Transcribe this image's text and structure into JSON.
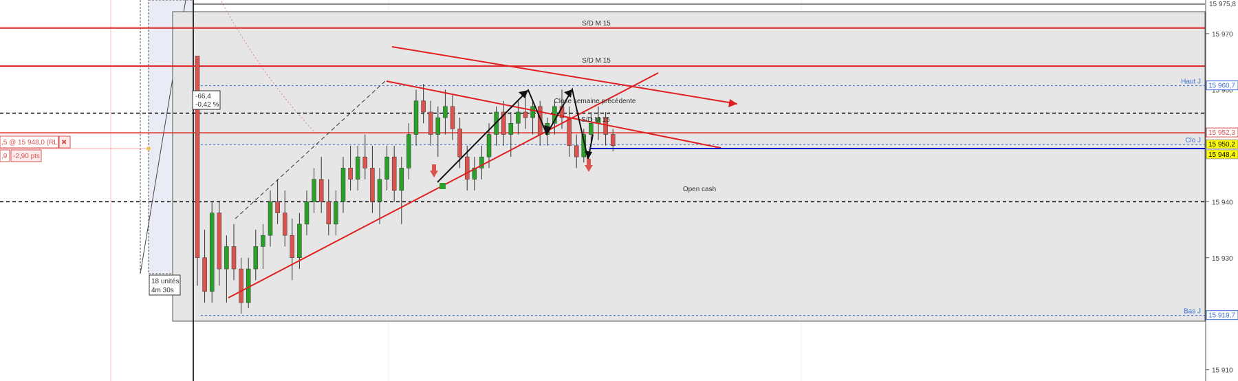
{
  "chart_data": {
    "type": "candlestick",
    "title": "",
    "xlabel": "",
    "ylabel": "",
    "ylim": [
      15908,
      15976
    ],
    "y_axis_side": "right",
    "y_ticks": [
      "15 970",
      "15 960",
      "15 950",
      "15 940",
      "15 930",
      "15 920",
      "15 910"
    ],
    "top_tick_partial": "15 975,8",
    "price_markers": [
      {
        "label": "Haut J",
        "value_text": "15 960,7",
        "value": 15960.7,
        "color": "#3a6fd8",
        "style": "dashed"
      },
      {
        "label": "",
        "value_text": "15 952,3",
        "value": 15952.3,
        "color": "#d9534f",
        "style": "solid"
      },
      {
        "label": "Clo J",
        "value_text": "15 950,2",
        "value": 15950.2,
        "color": "#3a6fd8",
        "style": "dashed",
        "highlight": "#ffff00"
      },
      {
        "label": "",
        "value_text": "15 948,4",
        "value": 15948.4,
        "color": "#0000cc",
        "style": "solid",
        "highlight": "#ffff00"
      },
      {
        "label": "Bas J",
        "value_text": "15 919,7",
        "value": 15919.7,
        "color": "#3a6fd8",
        "style": "dashed"
      }
    ],
    "horizontal_lines": [
      {
        "label": "S/D M 15",
        "value": 15971.0,
        "color": "#e02020"
      },
      {
        "label": "S/D M 15",
        "value": 15964.2,
        "color": "#e02020"
      },
      {
        "label": "Close semaine précédente",
        "value": 15955.8,
        "color": "#111111"
      },
      {
        "label": "Open cash",
        "value": 15940.0,
        "color": "#111111"
      }
    ],
    "candles_ohlc": [
      [
        15966,
        15966,
        15925,
        15930
      ],
      [
        15930,
        15935,
        15922,
        15924
      ],
      [
        15924,
        15940,
        15922,
        15938
      ],
      [
        15938,
        15940,
        15925,
        15928
      ],
      [
        15928,
        15934,
        15922,
        15932
      ],
      [
        15932,
        15936,
        15926,
        15928
      ],
      [
        15928,
        15930,
        15920,
        15922
      ],
      [
        15922,
        15930,
        15921,
        15928
      ],
      [
        15928,
        15935,
        15926,
        15932
      ],
      [
        15932,
        15936,
        15928,
        15934
      ],
      [
        15934,
        15942,
        15932,
        15940
      ],
      [
        15940,
        15944,
        15936,
        15938
      ],
      [
        15938,
        15942,
        15932,
        15934
      ],
      [
        15934,
        15937,
        15926,
        15930
      ],
      [
        15930,
        15938,
        15928,
        15936
      ],
      [
        15936,
        15942,
        15934,
        15940
      ],
      [
        15940,
        15946,
        15938,
        15944
      ],
      [
        15944,
        15948,
        15938,
        15940
      ],
      [
        15940,
        15944,
        15934,
        15936
      ],
      [
        15936,
        15942,
        15934,
        15940
      ],
      [
        15940,
        15948,
        15938,
        15946
      ],
      [
        15946,
        15950,
        15942,
        15944
      ],
      [
        15944,
        15950,
        15942,
        15948
      ],
      [
        15948,
        15952,
        15944,
        15946
      ],
      [
        15946,
        15950,
        15938,
        15940
      ],
      [
        15940,
        15946,
        15936,
        15944
      ],
      [
        15944,
        15950,
        15942,
        15948
      ],
      [
        15948,
        15950,
        15940,
        15942
      ],
      [
        15942,
        15948,
        15936,
        15946
      ],
      [
        15946,
        15954,
        15944,
        15952
      ],
      [
        15952,
        15960,
        15950,
        15958
      ],
      [
        15958,
        15961,
        15954,
        15956
      ],
      [
        15956,
        15958,
        15950,
        15952
      ],
      [
        15952,
        15957,
        15948,
        15955
      ],
      [
        15955,
        15960,
        15952,
        15957
      ],
      [
        15957,
        15959,
        15951,
        15953
      ],
      [
        15953,
        15955,
        15946,
        15948
      ],
      [
        15948,
        15950,
        15942,
        15944
      ],
      [
        15944,
        15948,
        15942,
        15946
      ],
      [
        15946,
        15950,
        15944,
        15948
      ],
      [
        15948,
        15954,
        15946,
        15952
      ],
      [
        15952,
        15957,
        15950,
        15956
      ],
      [
        15956,
        15958,
        15950,
        15952
      ],
      [
        15952,
        15956,
        15948,
        15954
      ],
      [
        15954,
        15958,
        15952,
        15956
      ],
      [
        15956,
        15959,
        15953,
        15955
      ],
      [
        15955,
        15958,
        15952,
        15957
      ],
      [
        15957,
        15958,
        15950,
        15952
      ],
      [
        15952,
        15955,
        15950,
        15954
      ],
      [
        15954,
        15958,
        15952,
        15957
      ],
      [
        15957,
        15960,
        15953,
        15955
      ],
      [
        15955,
        15957,
        15948,
        15950
      ],
      [
        15950,
        15952,
        15946,
        15948
      ],
      [
        15948,
        15953,
        15947,
        15952
      ],
      [
        15952,
        15956,
        15950,
        15954
      ],
      [
        15954,
        15957,
        15951,
        15955
      ],
      [
        15955,
        15956,
        15950,
        15952
      ],
      [
        15952,
        15953,
        15949,
        15950
      ]
    ],
    "tags": [
      {
        "label": "-66,4"
      },
      {
        "label": "-0,42 %"
      },
      {
        "label": "18 unités"
      },
      {
        "label": "4m 30s"
      }
    ]
  },
  "order": {
    "line1": ",5 @ 15 948,0 (RL)",
    "close_symbol": "✖",
    "left_value": ",9",
    "pts": "-2,90 pts"
  },
  "colors": {
    "up": "#2aa02a",
    "down": "#d9534f",
    "wick": "#333333",
    "zone": "#e6e6e6",
    "trend": "#e02020"
  }
}
